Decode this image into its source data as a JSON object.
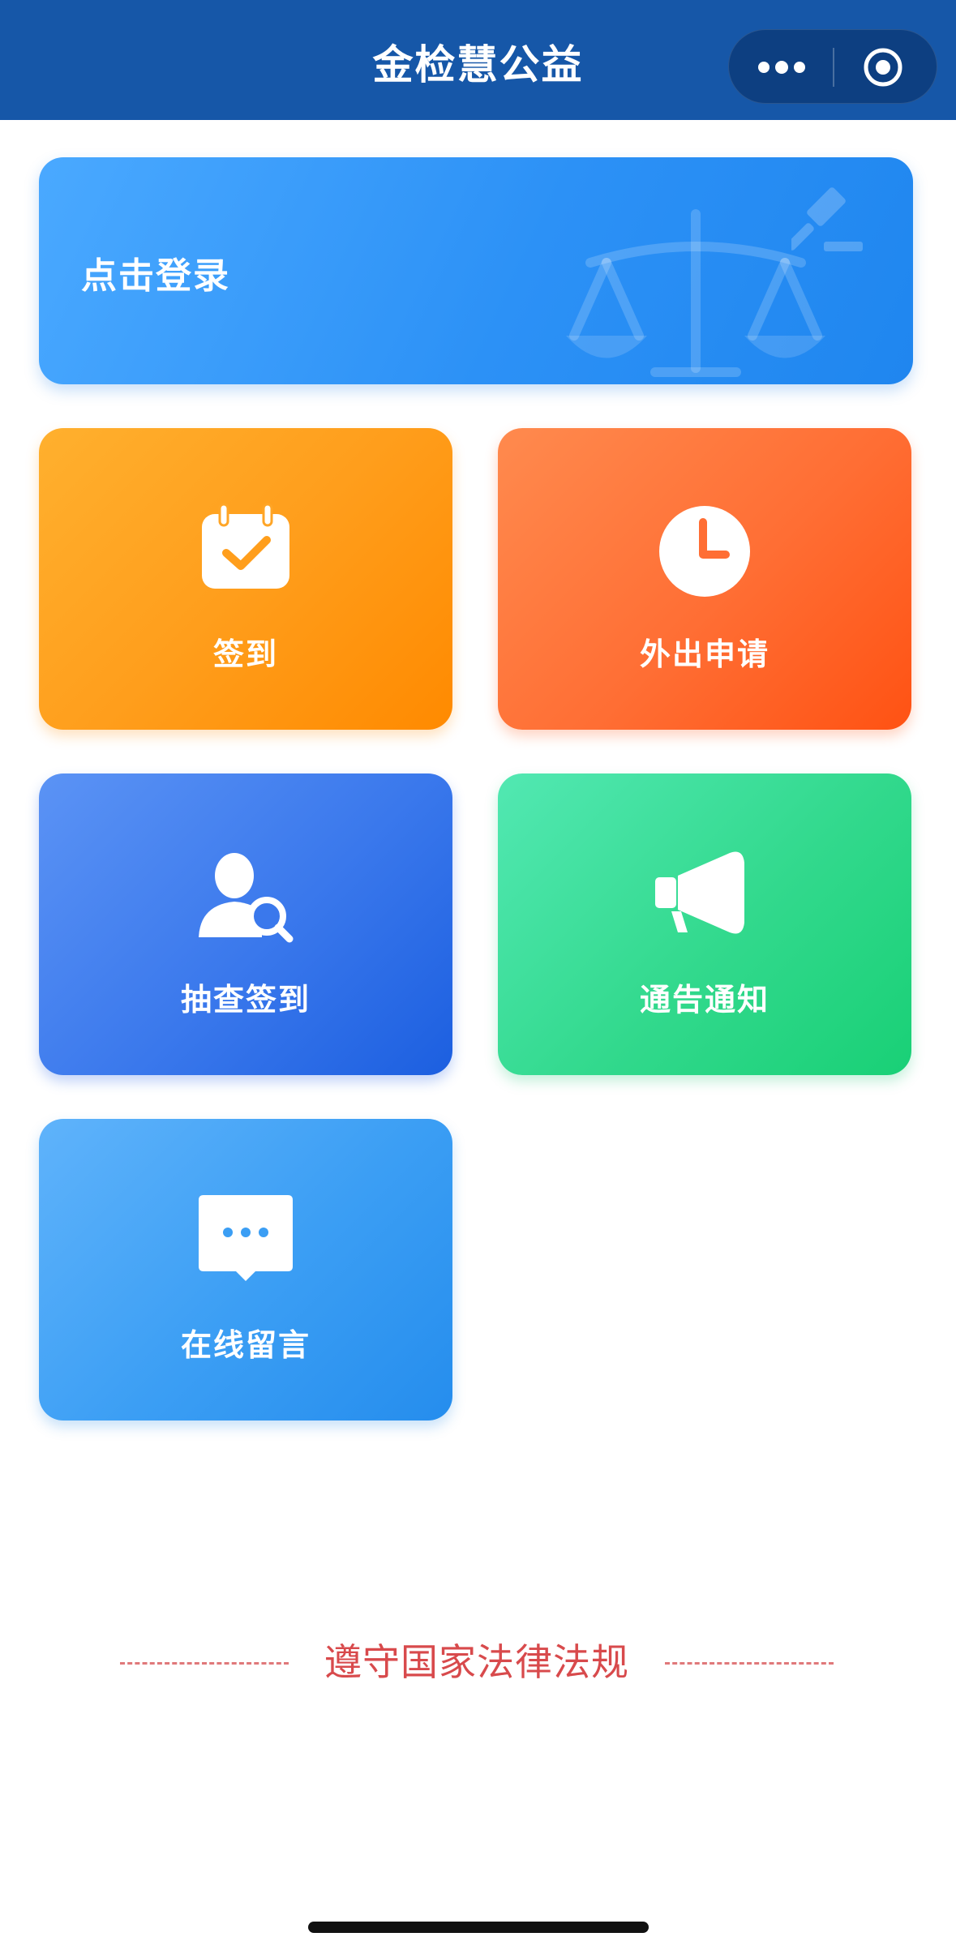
{
  "header": {
    "title": "金检慧公益",
    "more_icon": "more-dots-icon",
    "close_icon": "close-target-icon",
    "color": "#1657a8"
  },
  "login": {
    "label": "点击登录",
    "decoration_icons": [
      "scales-of-justice-icon",
      "gavel-icon"
    ]
  },
  "tiles": [
    {
      "label": "签到",
      "icon": "calendar-check-icon",
      "color": "#ff9e1c"
    },
    {
      "label": "外出申请",
      "icon": "clock-icon",
      "color": "#ff6e34"
    },
    {
      "label": "抽查签到",
      "icon": "user-search-icon",
      "color": "#3a78ec"
    },
    {
      "label": "通告通知",
      "icon": "megaphone-icon",
      "color": "#32d98d"
    },
    {
      "label": "在线留言",
      "icon": "chat-bubble-icon",
      "color": "#3b9ef4"
    }
  ],
  "footer": {
    "slogan": "遵守国家法律法规",
    "slogan_color": "#d84a4c"
  }
}
